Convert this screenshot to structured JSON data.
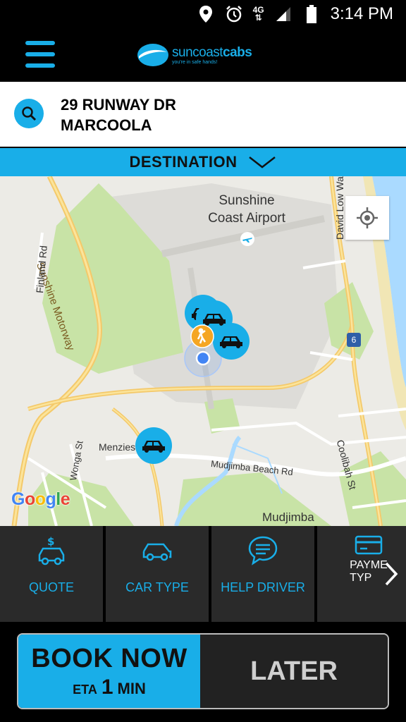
{
  "status_bar": {
    "network": "4G",
    "time": "3:14 PM",
    "icons": [
      "location-pin-icon",
      "alarm-icon",
      "signal-icon",
      "battery-icon"
    ]
  },
  "header": {
    "menu_icon": "hamburger-menu-icon",
    "logo": {
      "name_light": "suncoast",
      "name_bold": "cabs",
      "tagline": "you're in safe hands!"
    }
  },
  "pickup": {
    "line1": "29 RUNWAY DR",
    "line2": "MARCOOLA",
    "icon": "search-icon"
  },
  "destination": {
    "label": "DESTINATION",
    "icon": "chevron-down-icon"
  },
  "map": {
    "airport_line1": "Sunshine",
    "airport_line2": "Coast Airport",
    "roads": {
      "motorway": "Sunshine Motorway",
      "finland": "Finland Rd",
      "david_low": "David Low Way",
      "menzies": "Menzies",
      "mudjimba_beach": "Mudjimba Beach Rd",
      "coolibah": "Coolibah St",
      "wonga": "Wonga St"
    },
    "suburb": "Mudjimba",
    "highway_shield": "6",
    "attribution": "Google",
    "locate_icon": "my-location-icon",
    "nearby_cars": 4
  },
  "options": [
    {
      "label": "QUOTE",
      "icon": "quote-car-dollar-icon"
    },
    {
      "label": "CAR TYPE",
      "icon": "car-icon"
    },
    {
      "label": "HELP DRIVER",
      "icon": "chat-bubble-icon"
    },
    {
      "label_line1": "PAYME",
      "label_line2": "TYP",
      "icon": "credit-card-icon"
    }
  ],
  "options_next_icon": "chevron-right-icon",
  "booking": {
    "book_now": "BOOK NOW",
    "eta_label": "ETA",
    "eta_value": "1",
    "eta_unit": "MIN",
    "later": "LATER"
  },
  "colors": {
    "accent": "#19aee8",
    "dark_panel": "#2a2a2a",
    "background": "#000000"
  }
}
